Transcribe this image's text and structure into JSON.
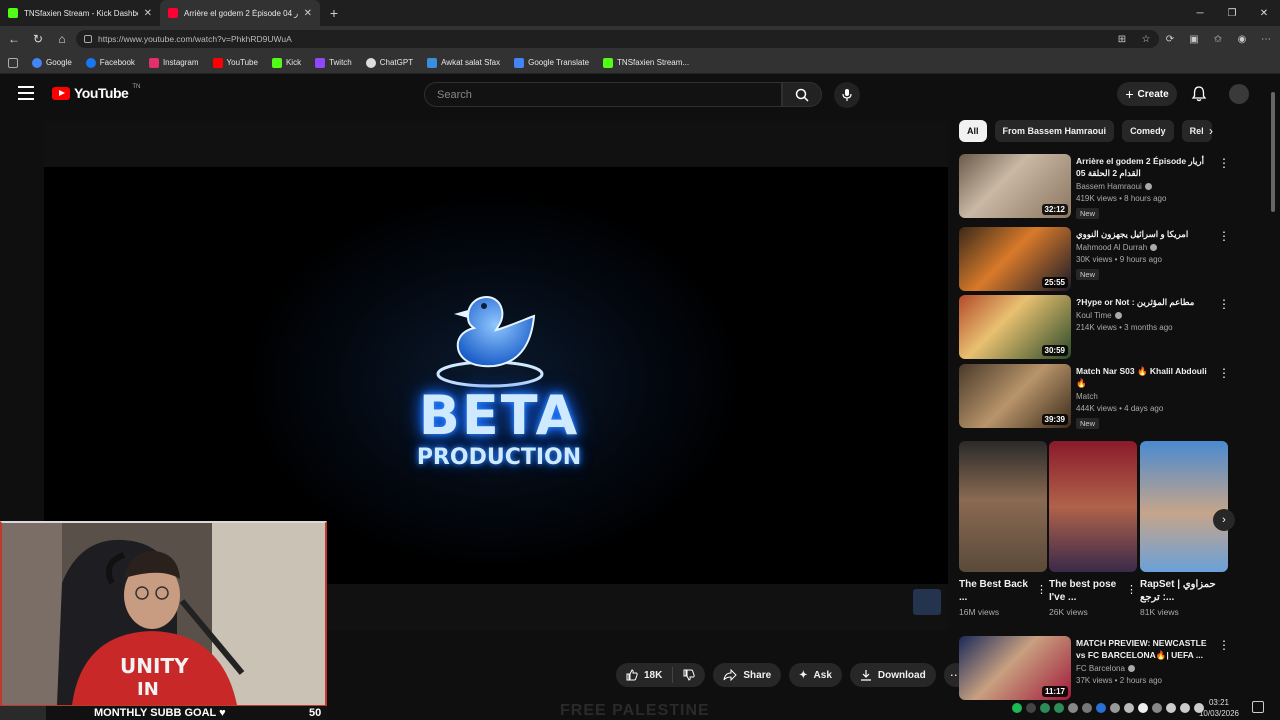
{
  "browser": {
    "tabs": [
      {
        "label": "TNSfaxien Stream - Kick Dashboar",
        "active": false
      },
      {
        "label": "Arrière el godem 2 Épisode 04 أر",
        "active": true
      }
    ],
    "url": "https://www.youtube.com/watch?v=PhkhRD9UWuA",
    "bookmarks": [
      "Google",
      "Facebook",
      "Instagram",
      "YouTube",
      "Kick",
      "Twitch",
      "ChatGPT",
      "Awkat salat Sfax",
      "Google Translate",
      "TNSfaxien Stream..."
    ]
  },
  "youtube": {
    "logo_text": "YouTube",
    "logo_region": "TN",
    "search_placeholder": "Search",
    "create_label": "Create",
    "player": {
      "logo_line1": "BETA",
      "logo_line2": "PRODUCTION"
    },
    "actions": {
      "likes": "18K",
      "share": "Share",
      "ask": "Ask",
      "download": "Download"
    },
    "footer_peek": "FREE PALESTINE",
    "chips": [
      "All",
      "From Bassem Hamraoui",
      "Comedy",
      "Rel"
    ],
    "recommendations": [
      {
        "title": "Arrière el godem 2 Épisode أريار القدام 2 الحلقة 05",
        "channel": "Bassem Hamraoui",
        "stats": "419K views • 8 hours ago",
        "badge": "New",
        "duration": "32:12"
      },
      {
        "title": "امريكا و اسرائيل يجهزون النووي",
        "channel": "Mahmood Al Durrah",
        "stats": "30K views • 9 hours ago",
        "badge": "New",
        "duration": "25:55"
      },
      {
        "title": "?Hype or Not : مطاعم المؤثرين",
        "channel": "Koul Time",
        "stats": "214K views • 3 months ago",
        "badge": "",
        "duration": "30:59"
      },
      {
        "title": "Match Nar S03 🔥 Khalil Abdouli 🔥",
        "channel": "Match",
        "stats": "444K views • 4 days ago",
        "badge": "New",
        "duration": "39:39"
      }
    ],
    "shorts": [
      {
        "title": "The Best Back ...",
        "views": "16M views"
      },
      {
        "title": "The best pose I've ...",
        "views": "26K views"
      },
      {
        "title": "RapSet | حمزاوي : ترجع...",
        "views": "81K views"
      }
    ],
    "bottom_reco": {
      "title": "MATCH PREVIEW: NEWCASTLE vs FC BARCELONA🔥| UEFA ...",
      "channel": "FC Barcelona",
      "stats": "37K views • 2 hours ago",
      "duration": "11:17"
    }
  },
  "stream_overlay": {
    "goal_label": "MONTHLY SUBB GOAL ♥",
    "goal_count": "50"
  },
  "system": {
    "time": "03:21",
    "date": "10/03/2026"
  }
}
